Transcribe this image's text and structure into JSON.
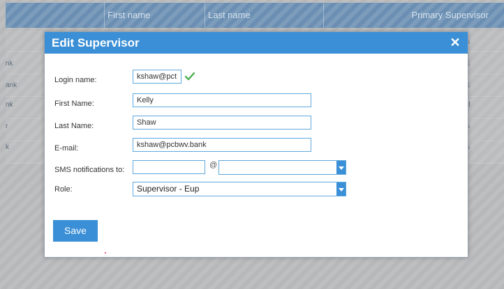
{
  "background": {
    "columns": [
      "First name",
      "Last name",
      "Primary Supervisor"
    ],
    "left_fragments": [
      "nk",
      "ank",
      "nk",
      "r",
      "k"
    ],
    "right_fragments": [
      "s",
      "1",
      "1",
      "d",
      "s",
      "s"
    ]
  },
  "modal": {
    "title": "Edit Supervisor",
    "close_symbol": "✕",
    "fields": {
      "login": {
        "label": "Login name:",
        "value": "kshaw@pct"
      },
      "first_name": {
        "label": "First Name:",
        "value": "Kelly"
      },
      "last_name": {
        "label": "Last Name:",
        "value": "Shaw"
      },
      "email": {
        "label": "E-mail:",
        "value": "kshaw@pcbwv.bank"
      },
      "sms": {
        "label": "SMS notifications to:",
        "value": "",
        "at": "@",
        "carrier_value": ""
      },
      "role": {
        "label": "Role:",
        "value": "Supervisor - Eup"
      }
    },
    "save_label": "Save"
  },
  "colors": {
    "accent": "#3a8fd6",
    "check": "#4caf50"
  },
  "icons": {
    "close": "close-icon",
    "check": "checkmark-icon",
    "dropdown": "chevron-down-icon"
  }
}
